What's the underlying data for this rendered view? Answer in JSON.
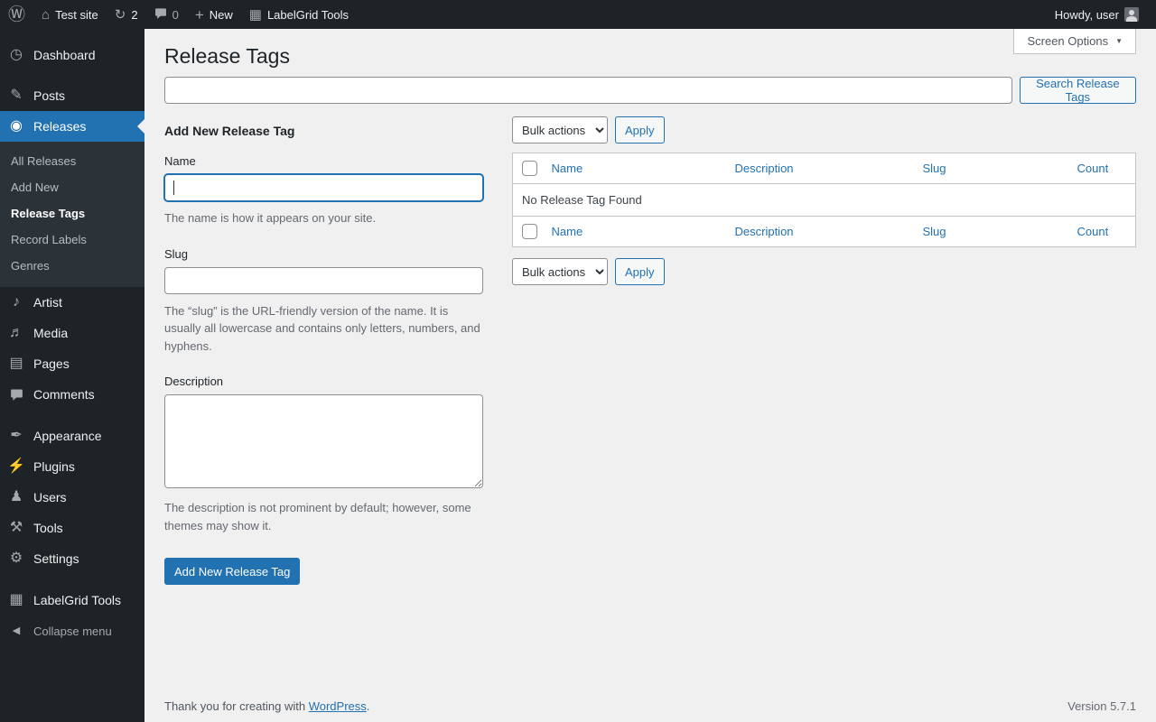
{
  "admin_bar": {
    "site_name": "Test site",
    "updates_count": "2",
    "comments_count": "0",
    "new_label": "New",
    "labelgrid_label": "LabelGrid Tools",
    "howdy_text": "Howdy, user"
  },
  "sidebar": {
    "items": [
      {
        "label": "Dashboard"
      },
      {
        "label": "Posts"
      },
      {
        "label": "Releases"
      },
      {
        "label": "Artist"
      },
      {
        "label": "Media"
      },
      {
        "label": "Pages"
      },
      {
        "label": "Comments"
      },
      {
        "label": "Appearance"
      },
      {
        "label": "Plugins"
      },
      {
        "label": "Users"
      },
      {
        "label": "Tools"
      },
      {
        "label": "Settings"
      },
      {
        "label": "LabelGrid Tools"
      },
      {
        "label": "Collapse menu"
      }
    ],
    "releases_submenu": [
      {
        "label": "All Releases"
      },
      {
        "label": "Add New"
      },
      {
        "label": "Release Tags"
      },
      {
        "label": "Record Labels"
      },
      {
        "label": "Genres"
      }
    ]
  },
  "page": {
    "title": "Release Tags",
    "screen_options_label": "Screen Options",
    "search_button_label": "Search Release Tags"
  },
  "form": {
    "heading": "Add New Release Tag",
    "name_label": "Name",
    "name_help": "The name is how it appears on your site.",
    "slug_label": "Slug",
    "slug_help": "The “slug” is the URL-friendly version of the name. It is usually all lowercase and contains only letters, numbers, and hyphens.",
    "description_label": "Description",
    "description_help": "The description is not prominent by default; however, some themes may show it.",
    "submit_label": "Add New Release Tag"
  },
  "list": {
    "bulk_actions_label": "Bulk actions",
    "apply_label": "Apply",
    "columns": [
      {
        "label": "Name"
      },
      {
        "label": "Description"
      },
      {
        "label": "Slug"
      },
      {
        "label": "Count"
      }
    ],
    "empty_message": "No Release Tag Found"
  },
  "footer": {
    "thanks_text": "Thank you for creating with",
    "wordpress_link": "WordPress",
    "suffix": ".",
    "version": "Version 5.7.1"
  },
  "colors": {
    "accent": "#2271b1",
    "admin_dark": "#1d2327",
    "content_bg": "#f0f0f1"
  }
}
